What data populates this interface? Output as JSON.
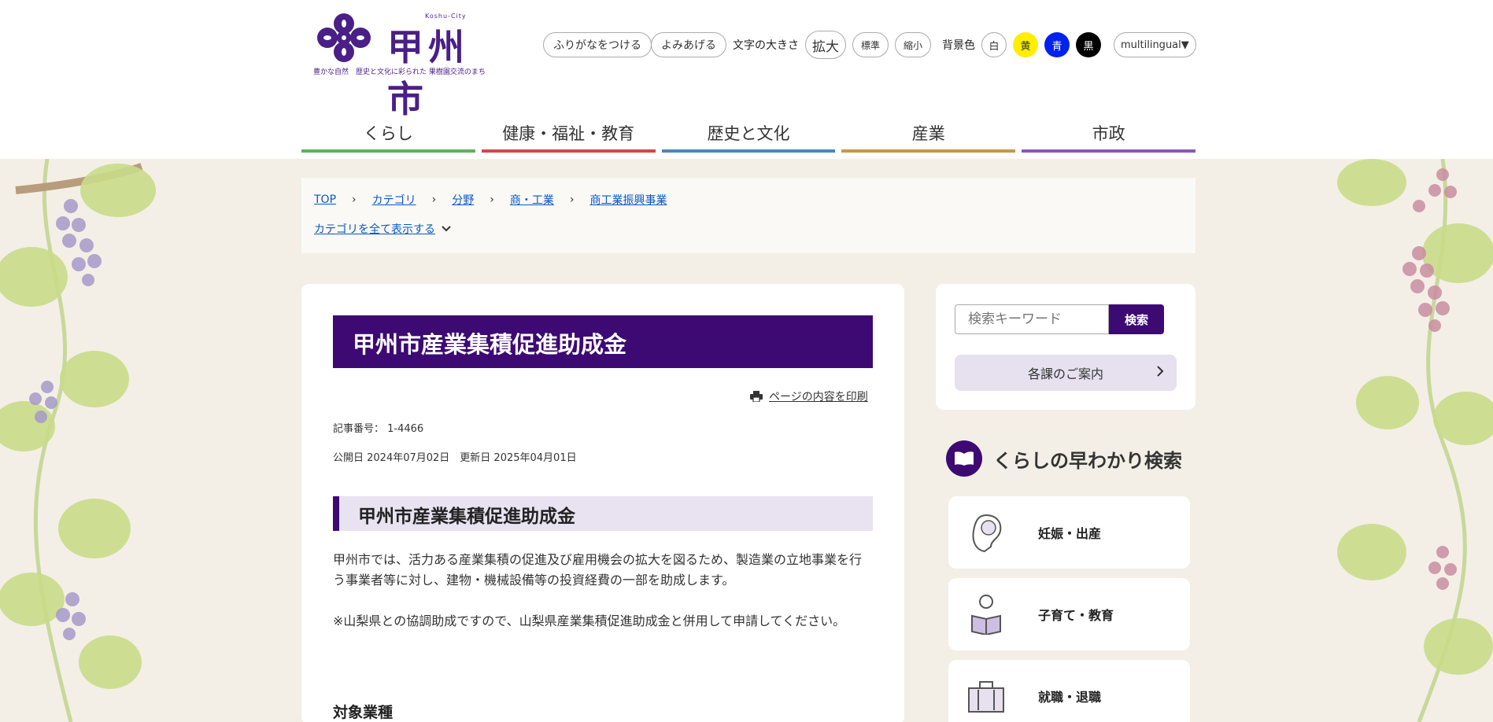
{
  "header": {
    "logo": {
      "title": "甲州市",
      "en": "Koshu-City",
      "tagline": "豊かな自然　歴史と文化に彩られた 果樹園交流のまち"
    },
    "furigana_label": "ふりがなをつける",
    "read_aloud_label": "よみあげる",
    "text_size_label": "文字の大きさ",
    "text_size": {
      "large": "拡大",
      "normal": "標準",
      "small": "縮小"
    },
    "bg_color_label": "背景色",
    "bg_colors": [
      {
        "label": "白",
        "bg": "#ffffff",
        "fg": "#333333"
      },
      {
        "label": "黄",
        "bg": "#ffee00",
        "fg": "#333333"
      },
      {
        "label": "青",
        "bg": "#0022ee",
        "fg": "#ffffff"
      },
      {
        "label": "黒",
        "bg": "#000000",
        "fg": "#ffffff"
      }
    ],
    "multilingual_label": "multilingual▼"
  },
  "global_nav": [
    {
      "label": "くらし",
      "color": "#5fb05f"
    },
    {
      "label": "健康・福祉・教育",
      "color": "#d04848"
    },
    {
      "label": "歴史と文化",
      "color": "#4a86b8"
    },
    {
      "label": "産業",
      "color": "#c8964a"
    },
    {
      "label": "市政",
      "color": "#8a58b8"
    }
  ],
  "breadcrumb": {
    "items": [
      "TOP",
      "カテゴリ",
      "分野",
      "商・工業",
      "商工業振興事業"
    ],
    "show_all_label": "カテゴリを全て表示する"
  },
  "article": {
    "title": "甲州市産業集積促進助成金",
    "print_label": "ページの内容を印刷",
    "article_number": "記事番号： 1-4466",
    "dates": "公開日 2024年07月02日　更新日 2025年04月01日",
    "heading": "甲州市産業集積促進助成金",
    "body_1": "甲州市では、活力ある産業集積の促進及び雇用機会の拡大を図るため、製造業の立地事業を行う事業者等に対し、建物・機械設備等の投資経費の一部を助成します。",
    "body_2": "※山梨県との協調助成ですので、山梨県産業集積促進助成金と併用して申請してください。",
    "subheading": "対象業種"
  },
  "sidebar": {
    "search_placeholder": "検索キーワード",
    "search_button": "検索",
    "departments_label": "各課のご案内",
    "quick_search_title": "くらしの早わかり検索",
    "quick_items": [
      {
        "label": "妊娠・出産",
        "icon": "pregnancy-icon"
      },
      {
        "label": "子育て・教育",
        "icon": "reading-child-icon"
      },
      {
        "label": "就職・退職",
        "icon": "briefcase-icon"
      }
    ]
  },
  "colors": {
    "brand_purple": "#3d0a73",
    "link_blue": "#0a58c4",
    "heading_bg": "#e8e2f1"
  }
}
